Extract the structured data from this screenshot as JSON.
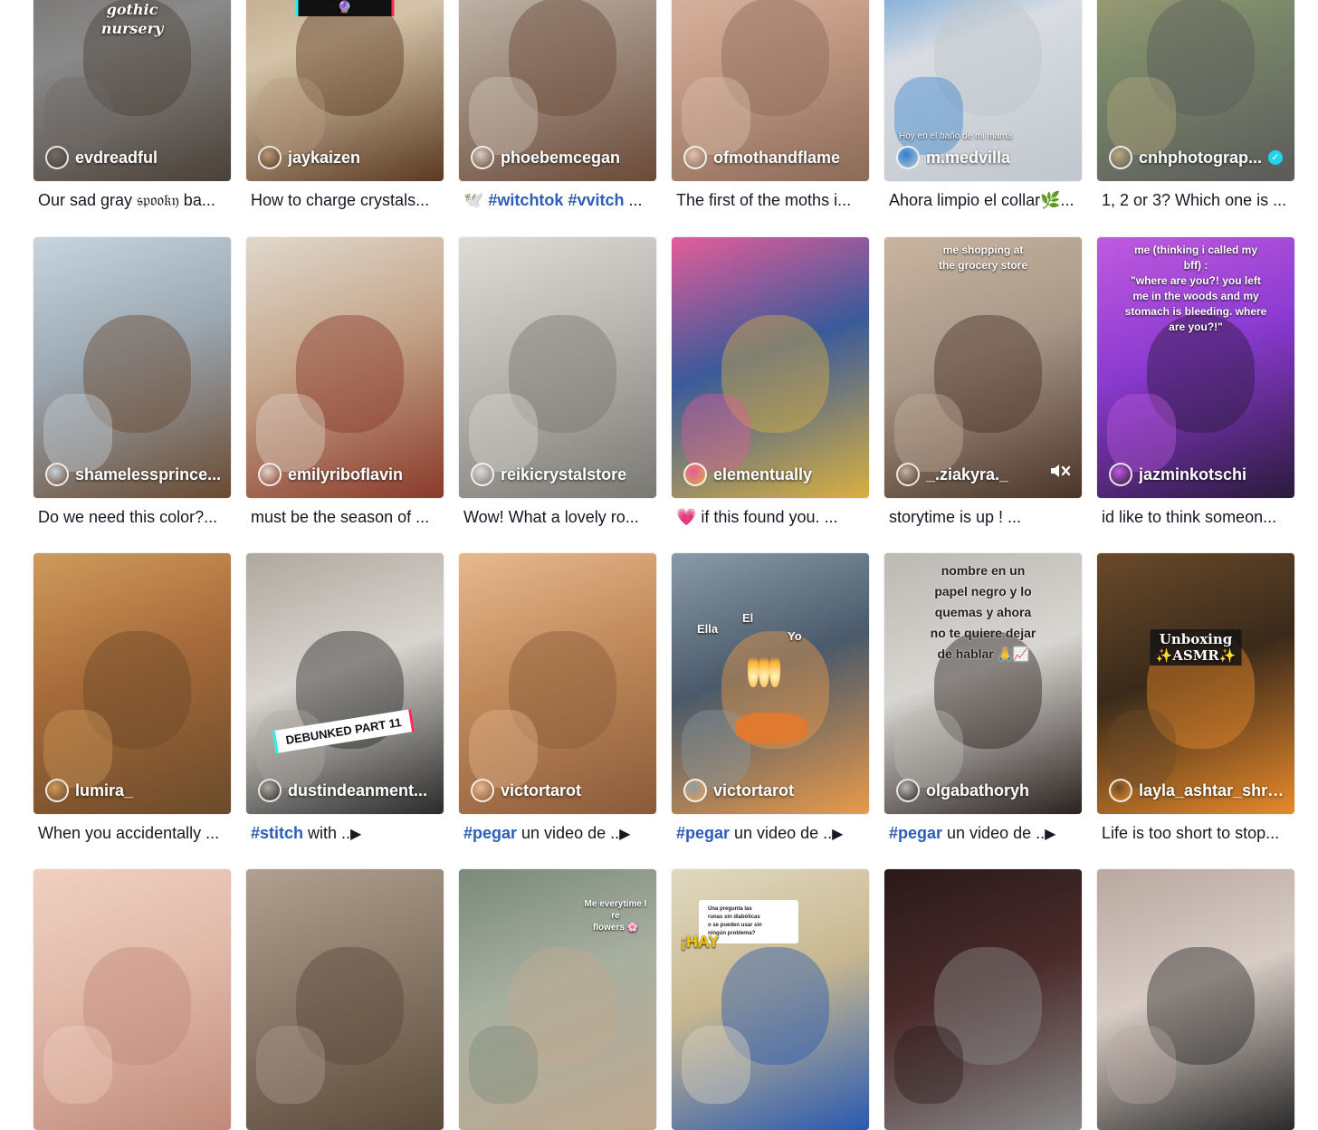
{
  "grid": {
    "rows": [
      [
        {
          "username": "evdreadful",
          "overlay_title": "let's build my\ngothic nursery",
          "caption_text": "Our sad gray 𝔰𝔭𝔬𝔬𝔨𝔶 ba...",
          "colors": [
            "#8a8a8a",
            "#4a4036",
            "#6d6a66"
          ]
        },
        {
          "username": "jaykaizen",
          "overlay_title": "Crystals ⚡️🔮",
          "caption_text": "How to charge crystals...",
          "colors": [
            "#d4c3a8",
            "#5b3a24",
            "#b89a7a"
          ]
        },
        {
          "username": "phoebemcegan",
          "caption_tags": [
            "#witchtok",
            "#vvitch"
          ],
          "caption_prefix": "🕊️ ",
          "caption_suffix": " ...",
          "colors": [
            "#a6978a",
            "#6b4a38",
            "#d8cdc2"
          ]
        },
        {
          "username": "ofmothandflame",
          "caption_text": "The first of the moths i...",
          "colors": [
            "#c9a08a",
            "#8a6a58",
            "#e1c3b2"
          ]
        },
        {
          "username": "m.medvilla",
          "overlay_bottom": "Hoy en el baño de mi mamá",
          "caption_text": "Ahora limpio el collar🌿...",
          "colors": [
            "#d9dde2",
            "#bfc6cd",
            "#2d7fd0"
          ]
        },
        {
          "username": "cnhphotograp...",
          "verified": true,
          "caption_text": "1, 2 or 3? Which one is ...",
          "colors": [
            "#7c8a6a",
            "#5a5a5a",
            "#b7aa7e"
          ]
        }
      ],
      [
        {
          "username": "shamelessprince...",
          "caption_text": "Do we need this color?...",
          "colors": [
            "#9aa6b0",
            "#6a4a30",
            "#c8d4de"
          ]
        },
        {
          "username": "emilyriboflavin",
          "caption_text": "must be the season of ...",
          "colors": [
            "#c4a58a",
            "#8a3a2a",
            "#e0d8cc"
          ]
        },
        {
          "username": "reikicrystalstore",
          "caption_text": "Wow! What a lovely ro...",
          "colors": [
            "#b8b6b0",
            "#7a7872",
            "#dedcd6"
          ]
        },
        {
          "username": "elementually",
          "caption_text": "💗 if this found you. ...",
          "colors": [
            "#3a5a9a",
            "#d8b040",
            "#e45c9a"
          ]
        },
        {
          "username": "_.ziakyra._",
          "overlay_top": "me shopping at\nthe grocery store",
          "muted": true,
          "caption_text": "storytime is up ! ...",
          "colors": [
            "#a89888",
            "#4a3428",
            "#c8b4a0"
          ]
        },
        {
          "username": "jazminkotschi",
          "overlay_top": "me (thinking i called my\nbff) :\n\"where are you?! you left\nme in the woods and my\nstomach is bleeding. where\nare you?!\"",
          "caption_text": "id like to think someon...",
          "colors": [
            "#8a3ad0",
            "#2a1a3a",
            "#c05ae0"
          ]
        }
      ],
      [
        {
          "username": "lumira_",
          "caption_text": "When you accidentally ...",
          "colors": [
            "#a66a3a",
            "#6a4a2a",
            "#d09a5a"
          ]
        },
        {
          "username": "dustindeanment...",
          "sticker": "DEBUNKED PART 11",
          "caption_tags": [
            "#stitch"
          ],
          "caption_suffix": " with ..",
          "play": true,
          "colors": [
            "#d8d4ce",
            "#2a2a2a",
            "#b0a8a0"
          ]
        },
        {
          "username": "victortarot",
          "caption_tags": [
            "#pegar"
          ],
          "caption_suffix": " un video de ..",
          "play": true,
          "colors": [
            "#c08a5a",
            "#8a5a3a",
            "#e8b890"
          ]
        },
        {
          "username": "victortarot",
          "overlay_labels": [
            "Ella",
            "El",
            "Yo"
          ],
          "caption_tags": [
            "#pegar"
          ],
          "caption_suffix": " un video de ..",
          "play": true,
          "colors": [
            "#4a5a6a",
            "#e89a4a",
            "#8a9aa6"
          ]
        },
        {
          "username": "olgabathoryh",
          "overlay_top": "nombre en un\npapel negro y lo\nquemas y ahora\nno te quiere dejar\nde hablar 🙏📈",
          "caption_tags": [
            "#pegar"
          ],
          "caption_suffix": " un video de ..",
          "play": true,
          "colors": [
            "#d8d6d2",
            "#2a2220",
            "#bcb8b2"
          ]
        },
        {
          "username": "layla_ashtar_shri...",
          "overlay_title": "Unboxing\n✨ASMR✨",
          "caption_text": "Life is too short to stop...",
          "colors": [
            "#3a2a1a",
            "#e88a2a",
            "#6a4a2a"
          ]
        }
      ],
      [
        {
          "overlay_top": "",
          "colors": [
            "#e0b8a8",
            "#c08a7a",
            "#f0d0c0"
          ]
        },
        {
          "colors": [
            "#8a7a6a",
            "#5a4a3a",
            "#b0a090"
          ]
        },
        {
          "overlay_top": "Me everytime I re\nflowers 🌸",
          "colors": [
            "#a8b0a0",
            "#c0a890",
            "#7a8a7a"
          ]
        },
        {
          "overlay_top": "Una pregunta las\nrunas sin diabólicas\no se pueden usar sin\nningún problema?",
          "sticker_text": "¡HAY",
          "colors": [
            "#c8b890",
            "#2a5ab0",
            "#e0d8c0"
          ]
        },
        {
          "colors": [
            "#4a2a2a",
            "#8a8a8a",
            "#2a1a1a"
          ]
        },
        {
          "colors": [
            "#d8ccc4",
            "#2a2a2a",
            "#b8a8a0"
          ]
        }
      ]
    ]
  }
}
